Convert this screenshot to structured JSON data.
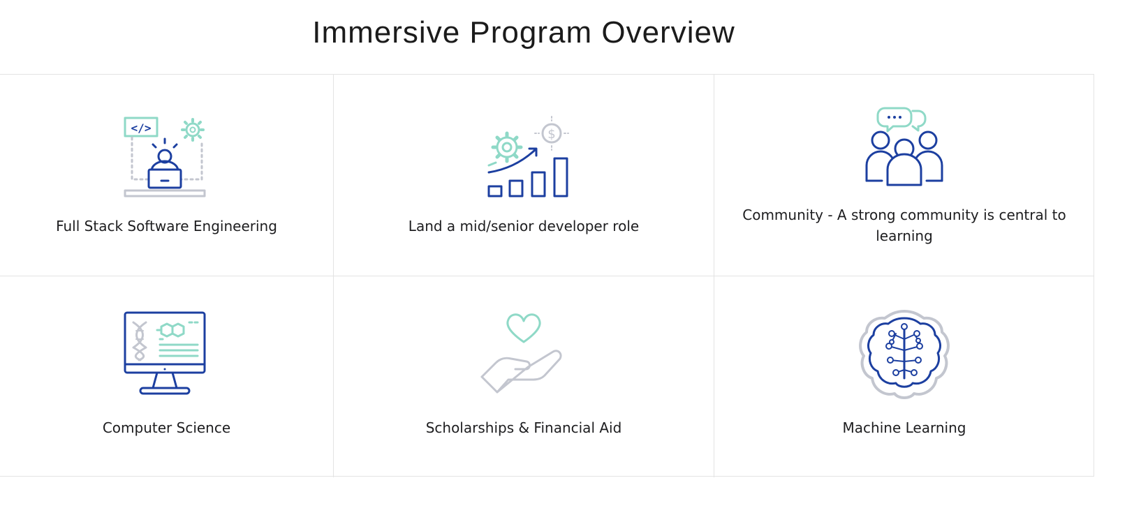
{
  "page": {
    "title": "Immersive Program Overview"
  },
  "colors": {
    "navy": "#1c3fa0",
    "mint": "#8fd9c7",
    "gray": "#c3c6cf",
    "border": "#e3e3e3"
  },
  "cards": [
    {
      "label": "Full Stack Software Engineering",
      "icon": "developer-laptop-icon"
    },
    {
      "label": "Land a mid/senior developer role",
      "icon": "growth-chart-icon"
    },
    {
      "label": "Community - A strong community is central to learning",
      "icon": "community-group-icon"
    },
    {
      "label": "Computer Science",
      "icon": "computer-dna-icon"
    },
    {
      "label": "Scholarships & Financial Aid",
      "icon": "heart-hand-icon"
    },
    {
      "label": "Machine Learning",
      "icon": "brain-tree-icon"
    }
  ]
}
